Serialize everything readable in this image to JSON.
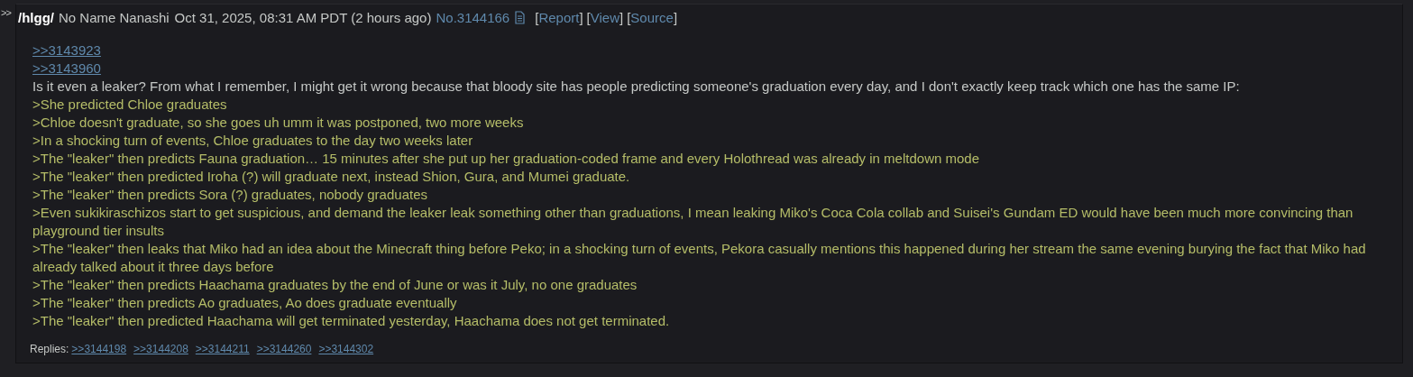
{
  "side_arrows": ">>",
  "post": {
    "board": "/hlgg/",
    "name": "No Name Nanashi",
    "date": "Oct 31, 2025, 08:31 AM PDT (2 hours ago)",
    "number": "No.3144166",
    "links": [
      {
        "before": "[",
        "label": "Report",
        "after": "]"
      },
      {
        "before": "[",
        "label": "View",
        "after": "]"
      },
      {
        "before": "[",
        "label": "Source",
        "after": "]"
      }
    ],
    "quotes": [
      ">>3143923",
      ">>3143960"
    ],
    "lines": [
      {
        "kind": "text",
        "text": "Is it even a leaker? From what I remember, I might get it wrong because that bloody site has people predicting someone's graduation every day, and I don't exactly keep track which one has the same IP:"
      },
      {
        "kind": "greentext",
        "text": ">She predicted Chloe graduates"
      },
      {
        "kind": "greentext",
        "text": ">Chloe doesn't graduate, so she goes uh umm it was postponed, two more weeks"
      },
      {
        "kind": "greentext",
        "text": ">In a shocking turn of events, Chloe graduates to the day two weeks later"
      },
      {
        "kind": "greentext",
        "text": ">The \"leaker\" then predicts Fauna graduation… 15 minutes after she put up her graduation-coded frame and every Holothread was already in meltdown mode"
      },
      {
        "kind": "greentext",
        "text": ">The \"leaker\" then predicted Iroha (?) will graduate next, instead Shion, Gura, and Mumei graduate."
      },
      {
        "kind": "greentext",
        "text": ">The \"leaker\" then predicts Sora (?) graduates, nobody graduates"
      },
      {
        "kind": "greentext",
        "text": ">Even sukikiraschizos start to get suspicious, and demand the leaker leak something other than graduations, I mean leaking Miko's Coca Cola collab and Suisei's Gundam ED would have been much more convincing than playground tier insults"
      },
      {
        "kind": "greentext",
        "text": ">The \"leaker\" then leaks that Miko had an idea about the Minecraft thing before Peko; in a shocking turn of events, Pekora casually mentions this happened during her stream the same evening burying the fact that Miko had already talked about it three days before"
      },
      {
        "kind": "greentext",
        "text": ">The \"leaker\" then predicts Haachama graduates by the end of June or was it July, no one graduates"
      },
      {
        "kind": "greentext",
        "text": ">The \"leaker\" then predicts Ao graduates, Ao does graduate eventually"
      },
      {
        "kind": "greentext",
        "text": ">The \"leaker\" then predicted Haachama will get terminated yesterday, Haachama does not get terminated."
      }
    ],
    "replies_label": "Replies:",
    "replies": [
      ">>3144198",
      ">>3144208",
      ">>3144211",
      ">>3144260",
      ">>3144302"
    ]
  }
}
